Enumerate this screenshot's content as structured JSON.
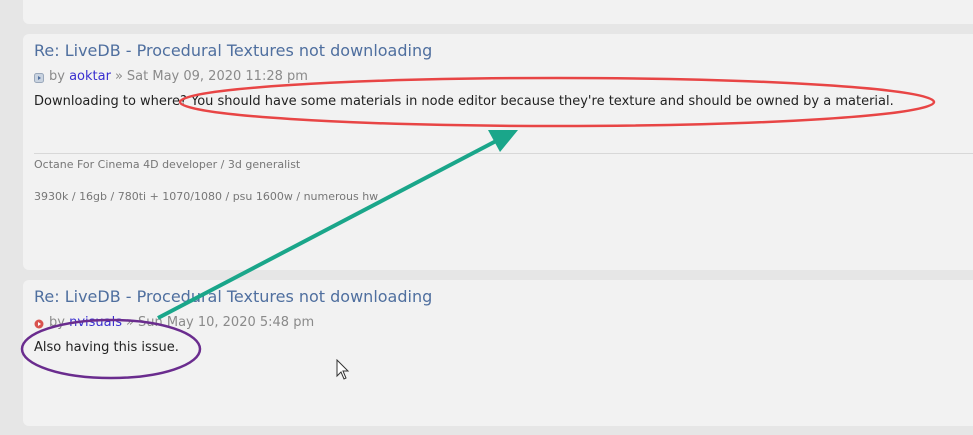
{
  "posts": [
    {
      "title": "Re: LiveDB - Procedural Textures not downloading",
      "by": "by",
      "author": "aoktar",
      "separator": "»",
      "date": "Sat May 09, 2020 11:28 pm",
      "body": "Downloading to where? You should have some materials in node editor because they're texture and should be owned by a material.",
      "signature_line1": "Octane For Cinema 4D developer / 3d generalist",
      "signature_line2": "3930k / 16gb / 780ti + 1070/1080 / psu 1600w / numerous hw",
      "icon": "post-read-icon"
    },
    {
      "title": "Re: LiveDB - Procedural Textures not downloading",
      "by": "by",
      "author": "nvisuals",
      "separator": "»",
      "date": "Sun May 10, 2020 5:48 pm",
      "body": "Also having this issue.",
      "icon": "post-unread-icon"
    }
  ],
  "annotations": {
    "highlight_colors": {
      "red_ellipse": "#e84545",
      "purple_ellipse": "#6a2c8e",
      "green_arrow": "#1aa68a"
    }
  },
  "colors": {
    "title": "#4f6f9f",
    "author": "#3a2fd0",
    "meta": "#8a8a8a",
    "post_bg": "#f2f2f2",
    "page_bg": "#e6e6e6"
  }
}
